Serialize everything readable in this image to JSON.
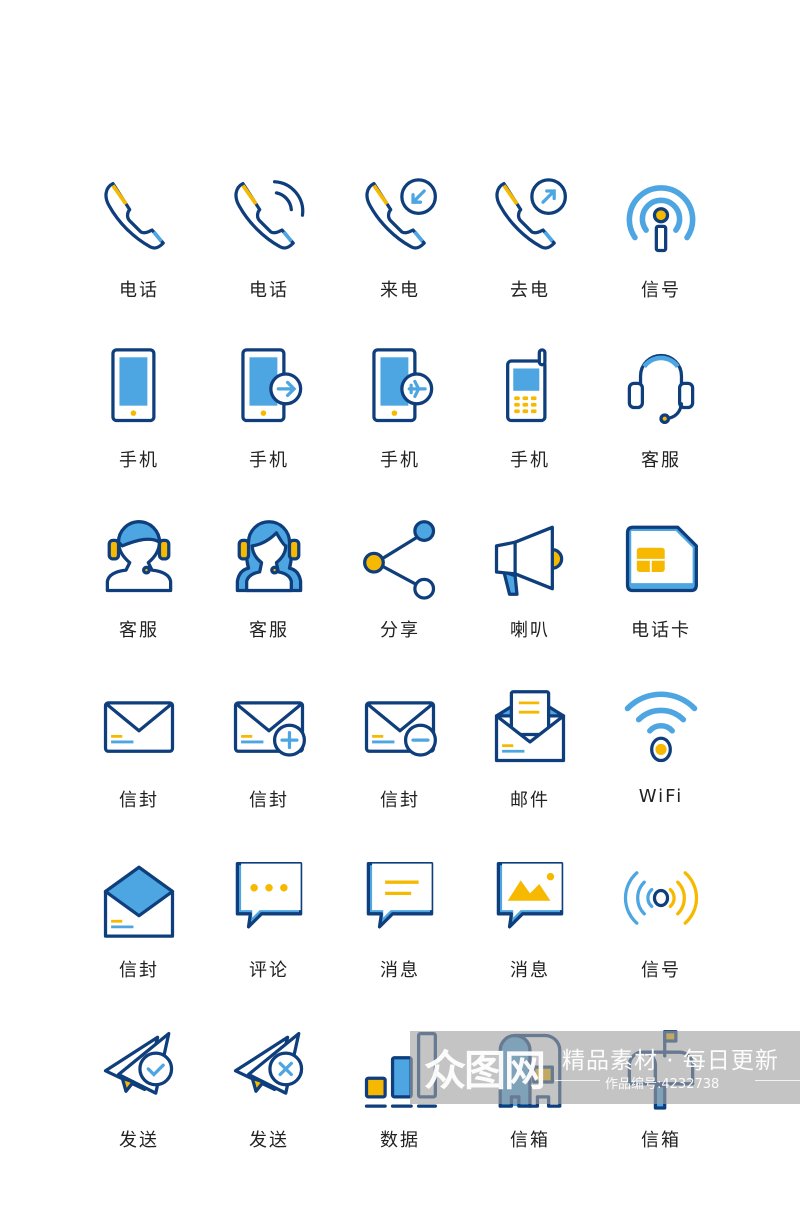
{
  "colors": {
    "navy": "#0f3e7c",
    "blue": "#4da6e2",
    "yellow": "#f6b900",
    "label": "#222222"
  },
  "rows": [
    [
      {
        "icon": "phone-icon",
        "label": "电话"
      },
      {
        "icon": "phone-ringing-icon",
        "label": "电话"
      },
      {
        "icon": "incoming-call-icon",
        "label": "来电"
      },
      {
        "icon": "outgoing-call-icon",
        "label": "去电"
      },
      {
        "icon": "signal-tower-icon",
        "label": "信号"
      }
    ],
    [
      {
        "icon": "smartphone-icon",
        "label": "手机"
      },
      {
        "icon": "smartphone-forward-icon",
        "label": "手机"
      },
      {
        "icon": "smartphone-airplane-icon",
        "label": "手机"
      },
      {
        "icon": "feature-phone-icon",
        "label": "手机"
      },
      {
        "icon": "headset-icon",
        "label": "客服"
      }
    ],
    [
      {
        "icon": "male-agent-icon",
        "label": "客服"
      },
      {
        "icon": "female-agent-icon",
        "label": "客服"
      },
      {
        "icon": "share-icon",
        "label": "分享"
      },
      {
        "icon": "megaphone-icon",
        "label": "喇叭"
      },
      {
        "icon": "sim-card-icon",
        "label": "电话卡"
      }
    ],
    [
      {
        "icon": "envelope-icon",
        "label": "信封"
      },
      {
        "icon": "envelope-add-icon",
        "label": "信封"
      },
      {
        "icon": "envelope-remove-icon",
        "label": "信封"
      },
      {
        "icon": "open-mail-letter-icon",
        "label": "邮件"
      },
      {
        "icon": "wifi-icon",
        "label": "WiFi"
      }
    ],
    [
      {
        "icon": "open-envelope-icon",
        "label": "信封"
      },
      {
        "icon": "comment-icon",
        "label": "评论"
      },
      {
        "icon": "message-icon",
        "label": "消息"
      },
      {
        "icon": "image-message-icon",
        "label": "消息"
      },
      {
        "icon": "broadcast-signal-icon",
        "label": "信号"
      }
    ],
    [
      {
        "icon": "send-check-icon",
        "label": "发送"
      },
      {
        "icon": "send-cancel-icon",
        "label": "发送"
      },
      {
        "icon": "bar-chart-icon",
        "label": "数据"
      },
      {
        "icon": "postbox-icon",
        "label": "信箱"
      },
      {
        "icon": "mailbox-flag-icon",
        "label": "信箱"
      }
    ]
  ],
  "watermark": {
    "logo": "众图网",
    "slogan": "精品素材 · 每日更新",
    "code": "作品编号:4232738"
  }
}
